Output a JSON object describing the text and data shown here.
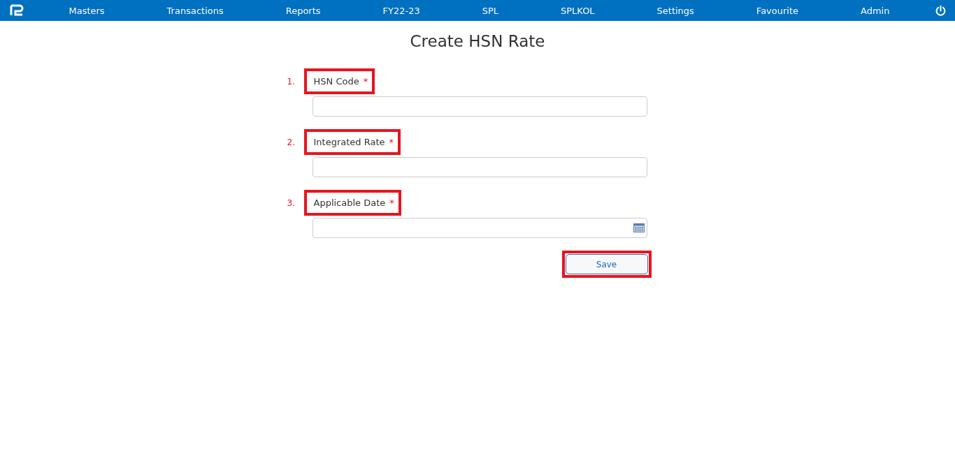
{
  "nav": {
    "items": [
      "Masters",
      "Transactions",
      "Reports",
      "FY22-23",
      "SPL",
      "SPLKOL",
      "Settings",
      "Favourite",
      "Admin"
    ]
  },
  "page": {
    "title": "Create HSN Rate"
  },
  "fields": [
    {
      "number": "1.",
      "label": "HSN Code",
      "required_mark": "*",
      "kind": "text",
      "highlighted": true
    },
    {
      "number": "2.",
      "label": "Integrated Rate",
      "required_mark": "*",
      "kind": "text",
      "highlighted": true
    },
    {
      "number": "3.",
      "label": "Applicable Date",
      "required_mark": "*",
      "kind": "date",
      "highlighted": true
    }
  ],
  "save_button": {
    "label": "Save",
    "highlighted": true
  }
}
